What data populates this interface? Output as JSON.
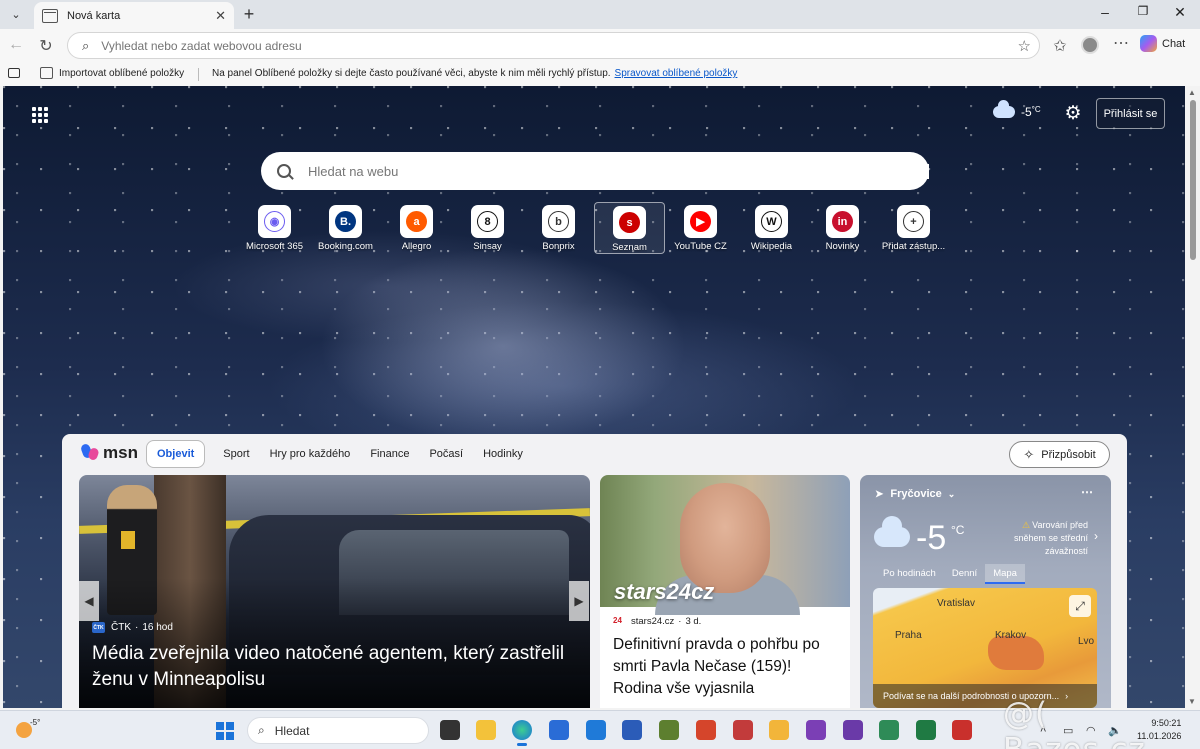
{
  "tabs": [
    {
      "title": "Nová karta"
    }
  ],
  "toolbar": {
    "address_placeholder": "Vyhledat nebo zadat webovou adresu",
    "chat_label": "Chat"
  },
  "favorites_bar": {
    "import_label": "Importovat oblíbené položky",
    "hint": "Na panel Oblíbené položky si dejte často používané věci, abyste k nim měli rychlý přístup.",
    "manage_link": "Spravovat oblíbené položky"
  },
  "newtab": {
    "weather_temp": "-5",
    "weather_unit": "°C",
    "signin_label": "Přihlásit se",
    "search_placeholder": "Hledat na webu",
    "quicklinks": [
      {
        "label": "Microsoft 365",
        "glyph": "◉",
        "bg": "#ffffff",
        "fg": "#6b5cf0"
      },
      {
        "label": "Booking.com",
        "glyph": "B.",
        "bg": "#003580",
        "fg": "#ffffff"
      },
      {
        "label": "Allegro",
        "glyph": "a",
        "bg": "#ff5a00",
        "fg": "#ffffff"
      },
      {
        "label": "Sinsay",
        "glyph": "8",
        "bg": "#ffffff",
        "fg": "#111111"
      },
      {
        "label": "Bonprix",
        "glyph": "b",
        "bg": "#ffffff",
        "fg": "#333333"
      },
      {
        "label": "Seznam",
        "glyph": "s",
        "bg": "#cc0000",
        "fg": "#ffffff"
      },
      {
        "label": "YouTube CZ",
        "glyph": "▶",
        "bg": "#ff0000",
        "fg": "#ffffff"
      },
      {
        "label": "Wikipedia",
        "glyph": "W",
        "bg": "#ffffff",
        "fg": "#111111"
      },
      {
        "label": "Novinky",
        "glyph": "in",
        "bg": "#c8102e",
        "fg": "#ffffff"
      },
      {
        "label": "Přidat zástup...",
        "glyph": "+",
        "bg": "#ffffff",
        "fg": "#333333"
      }
    ]
  },
  "msn": {
    "logo_text": "msn",
    "nav": [
      "Objevit",
      "Sport",
      "Hry pro každého",
      "Finance",
      "Počasí",
      "Hodinky"
    ],
    "customize_label": "Přizpůsobit",
    "hero": {
      "source": "ČTK",
      "source_logo": "ČTK",
      "age": "16 hod",
      "headline": "Média zveřejnila video natočené agentem, který zastřelil ženu v Minneapolisu"
    },
    "card2": {
      "watermark": "stars24cz",
      "source": "stars24.cz",
      "age": "3 d.",
      "title": "Definitivní pravda o pohřbu po smrti Pavla Nečase (159)! Rodina vše vyjasnila"
    },
    "weather": {
      "location": "Fryčovice",
      "temp": "-5",
      "unit": "°C",
      "warning": "Varování před sněhem se střední závažností",
      "tabs": [
        "Po hodinách",
        "Denní",
        "Mapa"
      ],
      "active_tab": "Mapa",
      "map_cities": [
        "Vratislav",
        "Praha",
        "Krakov",
        "Lvo"
      ],
      "map_bar": "Podívat se na další podrobnosti o upozorn..."
    }
  },
  "taskbar": {
    "weather_temp": "-5°",
    "search_placeholder": "Hledat",
    "time": "9:50:21",
    "date": "11.01.2026"
  },
  "watermark": "@( Bazos.cz"
}
